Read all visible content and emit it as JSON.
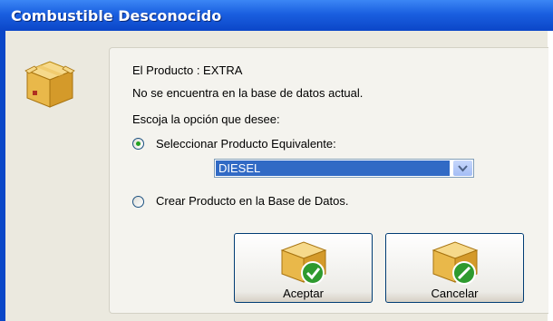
{
  "window": {
    "title": "Combustible Desconocido",
    "titlebar_color": "#0b46c8",
    "client_color": "#ebe9df"
  },
  "icons": {
    "main": "package-box-icon",
    "accept": "package-check-icon",
    "cancel": "package-cancel-icon"
  },
  "message": {
    "product_line": "El Producto : EXTRA",
    "not_found": "No se encuentra en la base de datos actual.",
    "choose_prompt": "Escoja la opción que desee:"
  },
  "options": {
    "equivalent": {
      "label": "Seleccionar Producto Equivalente:",
      "selected": true
    },
    "create": {
      "label": "Crear Producto en la Base de Datos.",
      "selected": false
    }
  },
  "product_select": {
    "value": "DIESEL",
    "highlight_color": "#316ac5"
  },
  "buttons": {
    "accept_label": "Aceptar",
    "cancel_label": "Cancelar"
  }
}
